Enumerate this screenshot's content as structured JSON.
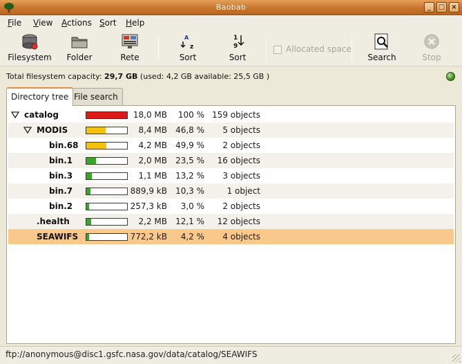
{
  "window": {
    "title": "Baobab",
    "app_icon": "tree-icon"
  },
  "menu": [
    {
      "label": "File",
      "mnemonic": "F"
    },
    {
      "label": "View",
      "mnemonic": "V"
    },
    {
      "label": "Actions",
      "mnemonic": "A"
    },
    {
      "label": "Sort",
      "mnemonic": "S"
    },
    {
      "label": "Help",
      "mnemonic": "H"
    }
  ],
  "toolbar": {
    "filesystem": {
      "label": "Filesystem",
      "icon": "harddisk-icon"
    },
    "folder": {
      "label": "Folder",
      "icon": "folder-icon"
    },
    "rete": {
      "label": "Rete",
      "icon": "network-icon"
    },
    "sort_alpha": {
      "label": "Sort",
      "icon": "sort-alpha-icon"
    },
    "sort_num": {
      "label": "Sort",
      "icon": "sort-numeric-icon"
    },
    "allocated": {
      "label": "Allocated space",
      "checked": false,
      "enabled": false
    },
    "search": {
      "label": "Search",
      "icon": "search-icon"
    },
    "stop": {
      "label": "Stop",
      "icon": "stop-icon",
      "enabled": false
    }
  },
  "capacity": {
    "prefix": "Total filesystem capacity: ",
    "total": "29,7 GB",
    "suffix": " (used: 4,2 GB available: 25,5 GB )"
  },
  "tabs": [
    {
      "label": "Directory tree",
      "active": true
    },
    {
      "label": "File search",
      "active": false
    }
  ],
  "tree": [
    {
      "name": "catalog",
      "level": 0,
      "expander": "expanded",
      "fill_pct": 100,
      "fill_color": "#dd1a1a",
      "size": "18,0 MB",
      "percent": "100 %",
      "objects": "159 objects"
    },
    {
      "name": "MODIS",
      "level": 1,
      "expander": "expanded",
      "fill_pct": 46.8,
      "fill_color": "#f3c20f",
      "size": "8,4 MB",
      "percent": "46,8 %",
      "objects": "5 objects"
    },
    {
      "name": "bin.68",
      "level": 2,
      "expander": "none",
      "fill_pct": 49.9,
      "fill_color": "#f3c20f",
      "size": "4,2 MB",
      "percent": "49,9 %",
      "objects": "2 objects"
    },
    {
      "name": "bin.1",
      "level": 2,
      "expander": "none",
      "fill_pct": 23.5,
      "fill_color": "#3aa52a",
      "size": "2,0 MB",
      "percent": "23,5 %",
      "objects": "16 objects"
    },
    {
      "name": "bin.3",
      "level": 2,
      "expander": "none",
      "fill_pct": 13.2,
      "fill_color": "#3aa52a",
      "size": "1,1 MB",
      "percent": "13,2 %",
      "objects": "3 objects"
    },
    {
      "name": "bin.7",
      "level": 2,
      "expander": "none",
      "fill_pct": 10.3,
      "fill_color": "#3aa52a",
      "size": "889,9 kB",
      "percent": "10,3 %",
      "objects": "1 object"
    },
    {
      "name": "bin.2",
      "level": 2,
      "expander": "none",
      "fill_pct": 3.0,
      "fill_color": "#3aa52a",
      "size": "257,3 kB",
      "percent": "3,0 %",
      "objects": "2 objects"
    },
    {
      "name": ".health",
      "level": 1,
      "expander": "none",
      "fill_pct": 12.1,
      "fill_color": "#3aa52a",
      "size": "2,2 MB",
      "percent": "12,1 %",
      "objects": "12 objects"
    },
    {
      "name": "SEAWIFS",
      "level": 1,
      "expander": "none",
      "fill_pct": 4.2,
      "fill_color": "#3aa52a",
      "size": "772,2 kB",
      "percent": "4,2 %",
      "objects": "4 objects",
      "selected": true
    }
  ],
  "statusbar": {
    "text": "ftp://anonymous@disc1.gsfc.nasa.gov/data/catalog/SEAWIFS"
  }
}
